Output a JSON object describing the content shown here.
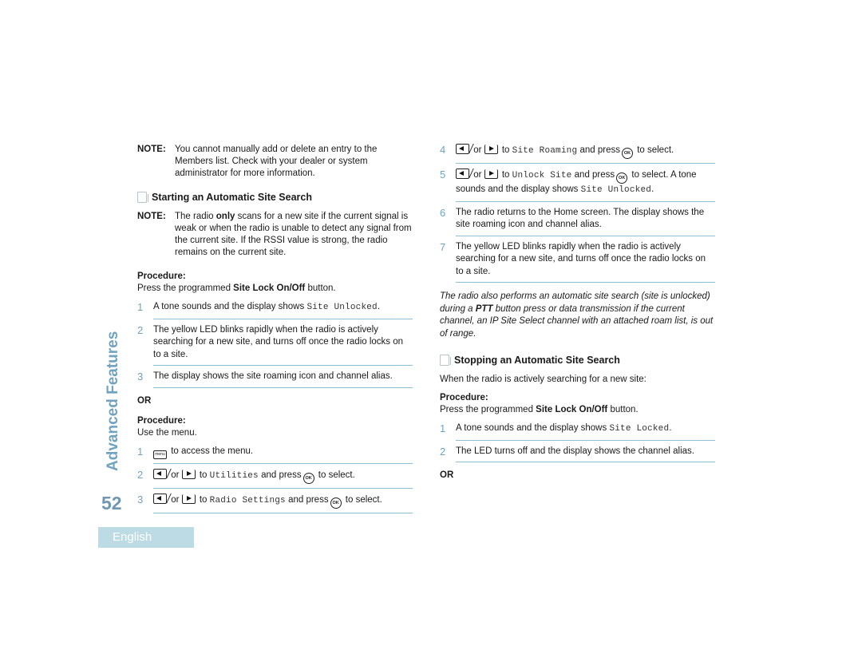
{
  "sidebar": {
    "section_title": "Advanced Features",
    "page_number": "52",
    "language_tab": "English"
  },
  "left": {
    "note1": {
      "label": "NOTE:",
      "text": "You cannot manually add or delete an entry to the Members list. Check with your dealer or system administrator for more information."
    },
    "heading": "Starting an Automatic Site Search",
    "note2": {
      "label": "NOTE:",
      "pre": "The radio ",
      "bold": "only",
      "post": " scans for a new site if the current signal is weak or when the radio is unable to detect any signal from the current site. If the RSSI value is strong, the radio remains on the current site."
    },
    "procedure1": {
      "label": "Procedure:",
      "pre": "Press the programmed ",
      "bold": "Site Lock On/Off",
      "post": " button."
    },
    "steps1": [
      {
        "num": "1",
        "pre": "A tone sounds and the display shows ",
        "mono": "Site Unlocked",
        "post": "."
      },
      {
        "num": "2",
        "text": "The yellow LED blinks rapidly when the radio is actively searching for a new site, and turns off once the radio locks on to a site."
      },
      {
        "num": "3",
        "text": "The display shows the site roaming icon and channel alias."
      }
    ],
    "or": "OR",
    "procedure2": {
      "label": "Procedure:",
      "text": "Use the menu."
    },
    "steps2": [
      {
        "num": "1",
        "key": "menu",
        "text": "to access the menu."
      },
      {
        "num": "2",
        "or": "or",
        "to": "to",
        "mono": "Utilities",
        "press": "and press",
        "select": "to select."
      },
      {
        "num": "3",
        "or": "or",
        "to": "to",
        "mono": "Radio Settings",
        "press": "and press",
        "select": "to select."
      }
    ]
  },
  "right": {
    "steps": [
      {
        "num": "4",
        "or": "or",
        "to": "to",
        "mono": "Site Roaming",
        "press": "and press",
        "select": "to select."
      },
      {
        "num": "5",
        "or": "or",
        "to": "to",
        "mono": "Unlock Site",
        "press": "and press",
        "select": "to select. A tone sounds and the display shows",
        "mono2": "Site Unlocked",
        "end": "."
      },
      {
        "num": "6",
        "text": "The radio returns to the Home screen. The display shows the site roaming icon and channel alias."
      },
      {
        "num": "7",
        "text": "The yellow LED blinks rapidly when the radio is actively searching for a new site, and turns off once the radio locks on to a site."
      }
    ],
    "italic_note": {
      "pre": "The radio also performs an automatic site search (site is unlocked) during a ",
      "bold": "PTT",
      "post": " button press or data transmission if the current channel, an IP Site Select channel with an attached roam list, is out of range."
    },
    "heading": "Stopping an Automatic Site Search",
    "intro": "When the radio is actively searching for a new site:",
    "procedure": {
      "label": "Procedure:",
      "pre": "Press the programmed ",
      "bold": "Site Lock On/Off",
      "post": " button."
    },
    "steps2": [
      {
        "num": "1",
        "pre": "A tone sounds and the display shows ",
        "mono": "Site Locked",
        "post": "."
      },
      {
        "num": "2",
        "text": "The LED turns off and the display shows the channel alias."
      }
    ],
    "or": "OR"
  },
  "icons": {
    "ok_label": "OK",
    "menu_label": "menu"
  },
  "colors": {
    "accent": "#6fa3c0",
    "divider": "#8fbfd4",
    "tab_bg": "#bcdbe5"
  }
}
